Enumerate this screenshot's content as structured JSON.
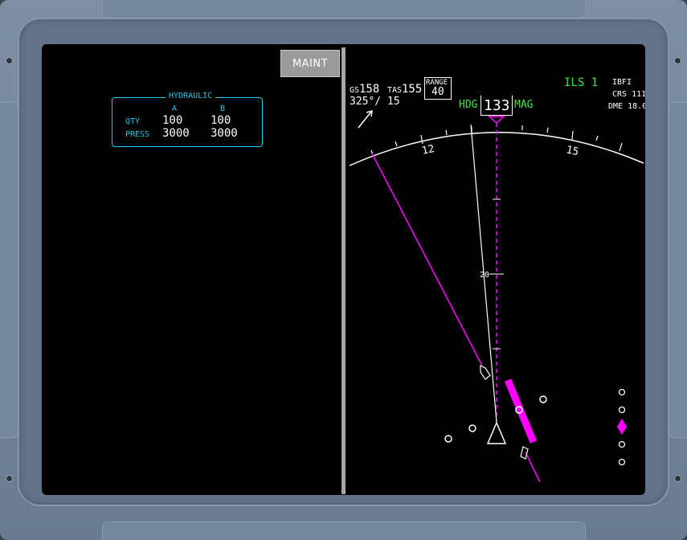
{
  "colors": {
    "cyan": "#22c6ec",
    "magenta": "#ff00ff",
    "green": "#3fe23f",
    "white": "#ffffff"
  },
  "maint_button": {
    "label": "MAINT"
  },
  "hydraulic": {
    "title": "HYDRAULIC",
    "col_a": "A",
    "col_b": "B",
    "qty": {
      "label": "QTY",
      "a": "100",
      "b": "100"
    },
    "press": {
      "label": "PRESS",
      "a": "3000",
      "b": "3000"
    }
  },
  "nav": {
    "gs_label": "GS",
    "gs_value": "158",
    "tas_label": "TAS",
    "tas_value": "155",
    "wind": "325°/ 15",
    "range_label": "RANGE",
    "range_value": "40",
    "hdg_label": "HDG",
    "heading": "133",
    "mag_label": "MAG",
    "compass_labels": {
      "left": "12",
      "right": "15"
    },
    "ils_label": "ILS 1",
    "ident": "IBFI",
    "crs": "CRS 111",
    "dme": "DME 18.0",
    "range_mark": "20",
    "glideslope_icon": "magenta-diamond-icon"
  }
}
